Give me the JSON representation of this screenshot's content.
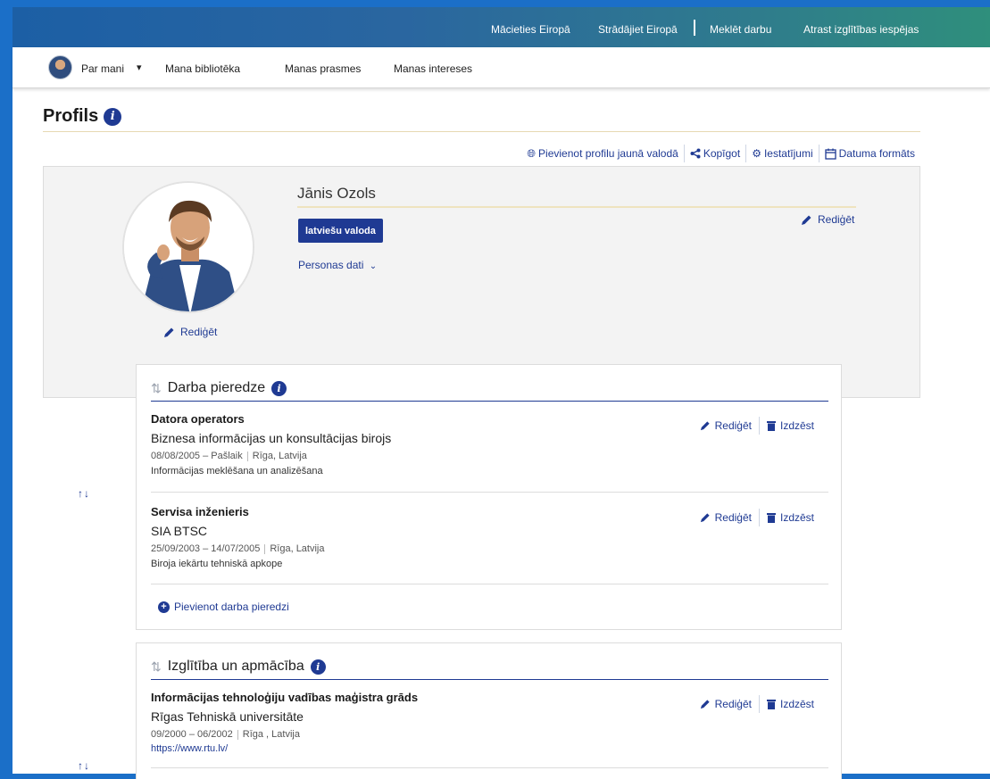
{
  "topbar": {
    "links": [
      "Mācieties Eiropā",
      "Strādājiet Eiropā",
      "Meklēt darbu",
      "Atrast izglītības iespējas"
    ]
  },
  "nav": {
    "about": "Par mani",
    "library": "Mana bibliotēka",
    "skills": "Manas prasmes",
    "interests": "Manas intereses"
  },
  "page": {
    "title": "Profils"
  },
  "toolbar": {
    "add_language": "Pievienot profilu jaunā valodā",
    "share": "Kopīgot",
    "settings": "Iestatījumi",
    "date_format": "Datuma formāts"
  },
  "profile": {
    "name": "Jānis Ozols",
    "language_badge": "latviešu valoda",
    "personal_data": "Personas dati",
    "edit": "Rediģēt",
    "photo_edit": "Rediģēt"
  },
  "work": {
    "title": "Darba pieredze",
    "entries": [
      {
        "job": "Datora operators",
        "org": "Biznesa informācijas un konsultācijas birojs",
        "dates": "08/08/2005 – Pašlaik",
        "place": "Rīga, Latvija",
        "desc": "Informācijas meklēšana un analizēšana"
      },
      {
        "job": "Servisa inženieris",
        "org": "SIA BTSC",
        "dates": "25/09/2003 – 14/07/2005",
        "place": "Rīga, Latvija",
        "desc": "Biroja iekārtu tehniskā apkope"
      }
    ],
    "add": "Pievienot darba pieredzi"
  },
  "education": {
    "title": "Izglītība un apmācība",
    "entries": [
      {
        "job": "Informācijas tehnoloģiju vadības maģistra grāds",
        "org": "Rīgas Tehniskā universitāte",
        "dates": "09/2000 – 06/2002",
        "place": "Rīga , Latvija",
        "url": "https://www.rtu.lv/"
      }
    ]
  },
  "actions": {
    "edit": "Rediģēt",
    "delete": "Izdzēst"
  },
  "icons": {
    "info": "info-icon",
    "globe": "globe-icon",
    "share": "share-icon",
    "gear": "gear-icon",
    "calendar": "calendar-icon",
    "pencil": "pencil-icon",
    "trash": "trash-icon",
    "sort": "sort-icon",
    "plus": "plus-circle-icon",
    "arrows": "move-arrows-icon"
  },
  "colors": {
    "accent": "#1f3a93",
    "topbar_start": "#1c5fa5",
    "topbar_end": "#2f8f7c",
    "frame": "#1b6fc8"
  }
}
